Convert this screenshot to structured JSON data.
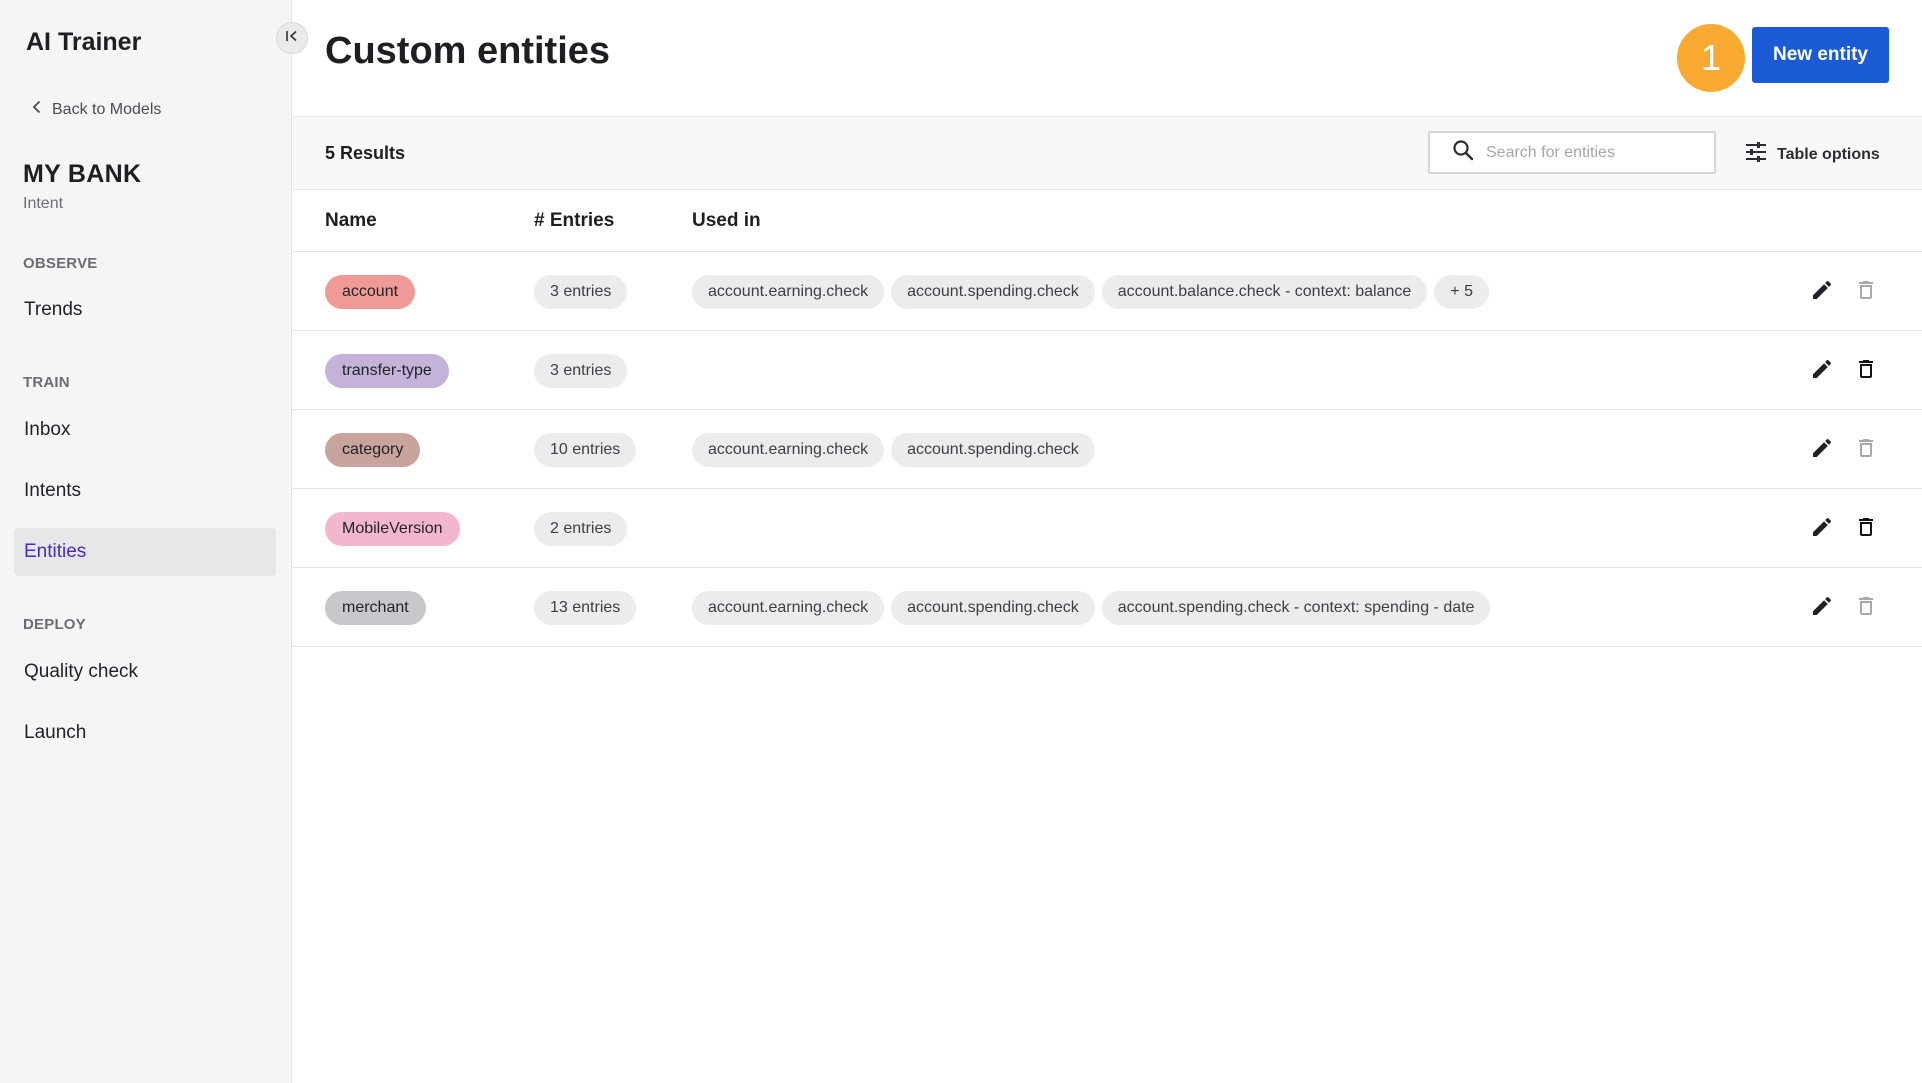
{
  "sidebar": {
    "app_title": "AI Trainer",
    "back_label": "Back to Models",
    "model_name": "MY BANK",
    "model_type": "Intent",
    "sections": [
      {
        "label": "OBSERVE",
        "items": [
          {
            "label": "Trends"
          }
        ]
      },
      {
        "label": "TRAIN",
        "items": [
          {
            "label": "Inbox"
          },
          {
            "label": "Intents"
          },
          {
            "label": "Entities",
            "active": true
          }
        ]
      },
      {
        "label": "DEPLOY",
        "items": [
          {
            "label": "Quality check"
          },
          {
            "label": "Launch"
          }
        ]
      }
    ]
  },
  "header": {
    "title": "Custom entities",
    "step_badge": "1",
    "new_entity_label": "New entity",
    "accent_color": "#1c5bd6",
    "badge_color": "#f7a932"
  },
  "toolbar": {
    "results_label": "5 Results",
    "search_placeholder": "Search for entities",
    "search_value": "",
    "table_options_label": "Table options"
  },
  "table": {
    "columns": [
      "Name",
      "# Entries",
      "Used in"
    ],
    "rows": [
      {
        "name": "account",
        "color": "#ef9a96",
        "entries": "3 entries",
        "used_in": [
          "account.earning.check",
          "account.spending.check",
          "account.balance.check - context: balance",
          "+ 5"
        ],
        "delete_enabled": false
      },
      {
        "name": "transfer-type",
        "color": "#c4b2d8",
        "entries": "3 entries",
        "used_in": [],
        "delete_enabled": true
      },
      {
        "name": "category",
        "color": "#c9a49d",
        "entries": "10 entries",
        "used_in": [
          "account.earning.check",
          "account.spending.check"
        ],
        "delete_enabled": false
      },
      {
        "name": "MobileVersion",
        "color": "#f3b6cf",
        "entries": "2 entries",
        "used_in": [],
        "delete_enabled": true
      },
      {
        "name": "merchant",
        "color": "#c7c8cb",
        "entries": "13 entries",
        "used_in": [
          "account.earning.check",
          "account.spending.check",
          "account.spending.check - context: spending - date"
        ],
        "delete_enabled": false
      }
    ]
  }
}
